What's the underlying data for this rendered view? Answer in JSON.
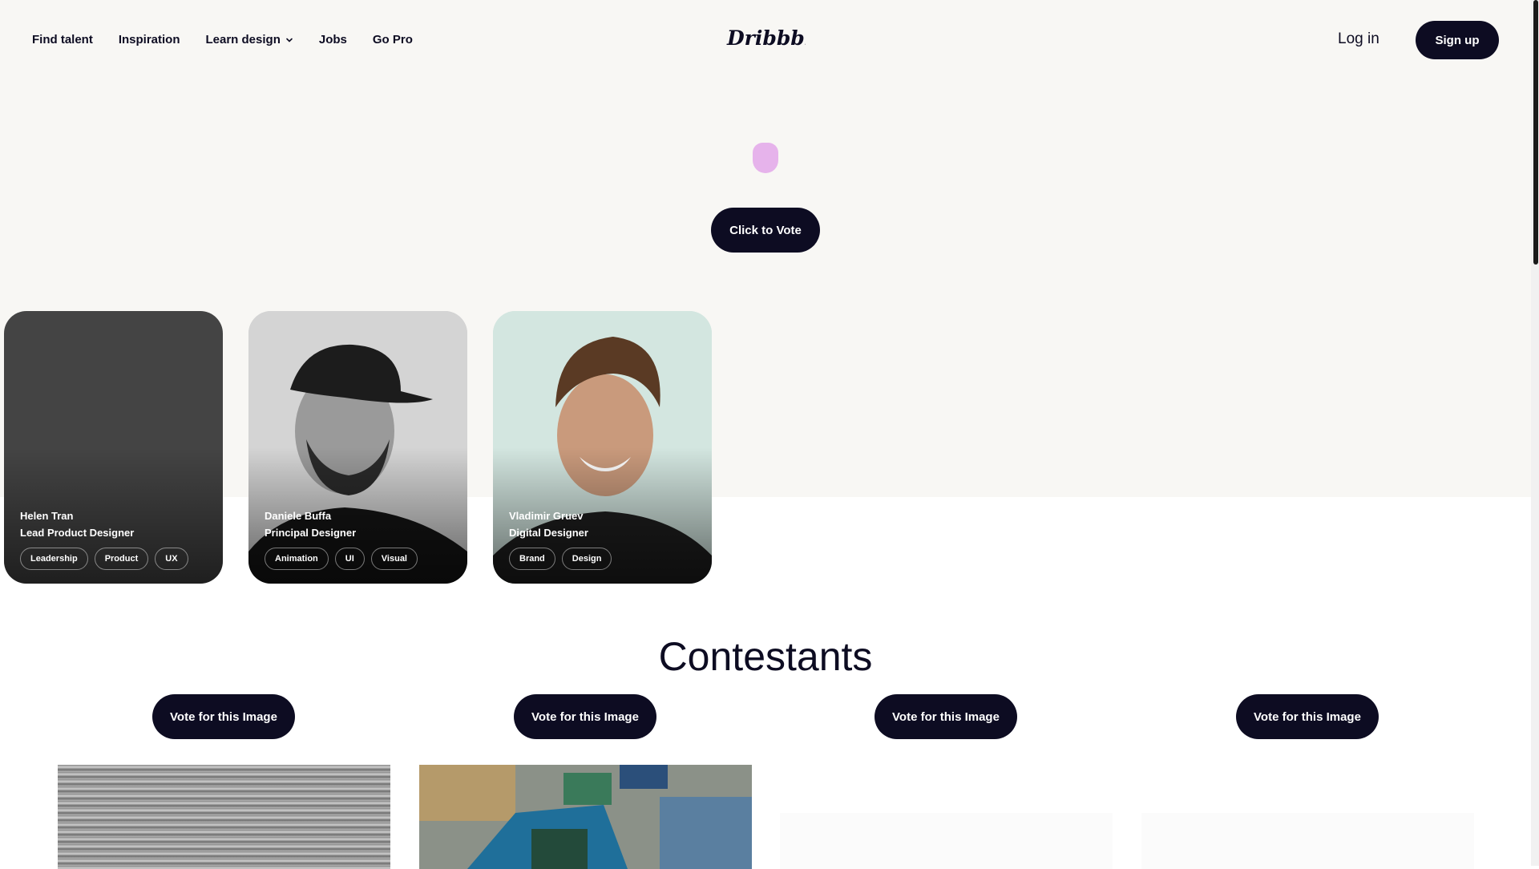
{
  "nav": {
    "links": [
      "Find talent",
      "Inspiration",
      "Learn design",
      "Jobs",
      "Go Pro"
    ],
    "logo_text": "Dribbble",
    "login": "Log in",
    "signup": "Sign up"
  },
  "hero": {
    "vote_label": "Click to Vote"
  },
  "cards": [
    {
      "name": "Helen Tran",
      "role": "Lead Product Designer",
      "tags": [
        "Leadership",
        "Product",
        "UX"
      ]
    },
    {
      "name": "Daniele Buffa",
      "role": "Principal Designer",
      "tags": [
        "Animation",
        "UI",
        "Visual"
      ]
    },
    {
      "name": "Vladimir Gruev",
      "role": "Digital Designer",
      "tags": [
        "Brand",
        "Design"
      ]
    }
  ],
  "contestants": {
    "title": "Contestants",
    "vote_buttons": [
      "Vote for this Image",
      "Vote for this Image",
      "Vote for this Image",
      "Vote for this Image"
    ]
  },
  "colors": {
    "brand_dark": "#0d0c22",
    "hero_bg": "#f8f7f4",
    "blob": "#e6b3eb"
  },
  "icons": {
    "chevron": "chevron-down-icon",
    "logo": "dribbble-logo"
  }
}
